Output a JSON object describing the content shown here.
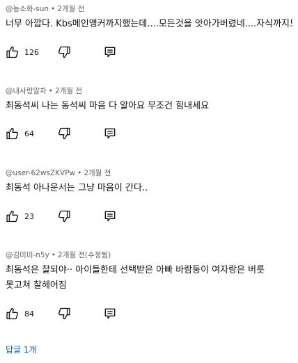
{
  "comments": [
    {
      "author": "@능소화-sun",
      "time": "2개월 전",
      "edited": "",
      "text": "너무 아깝다. Kbs메인앵커까지했는데....모든것을 앗아가버렸네....자식까지도...",
      "likes": "126"
    },
    {
      "author": "@내사랑알차",
      "time": "2개월 전",
      "edited": "",
      "text": "최동석씨 나는 동석씨 마음 다  알아요   무조건  힘내세요",
      "likes": "64"
    },
    {
      "author": "@user-62wsZKVPw",
      "time": "2개월 전",
      "edited": "",
      "text": "최동석 아나운서는 그냥 마음이 간다..",
      "likes": "23"
    },
    {
      "author": "@김미미-n5y",
      "time": "2개월 전",
      "edited": "(수정됨)",
      "text": "최동석은 찰되야··  아이들한테  선택받은 아빠  바람둥이 여자랑은  버릇 못고쳐 찰헤어짐",
      "likes": "84"
    }
  ],
  "replies_link": "답글 1개",
  "icons": {
    "like": "thumbs-up-icon",
    "dislike": "thumbs-down-icon",
    "reply": "reply-comment-icon"
  },
  "colors": {
    "text": "#0f0f0f",
    "meta": "#606060",
    "link": "#065fd4"
  }
}
